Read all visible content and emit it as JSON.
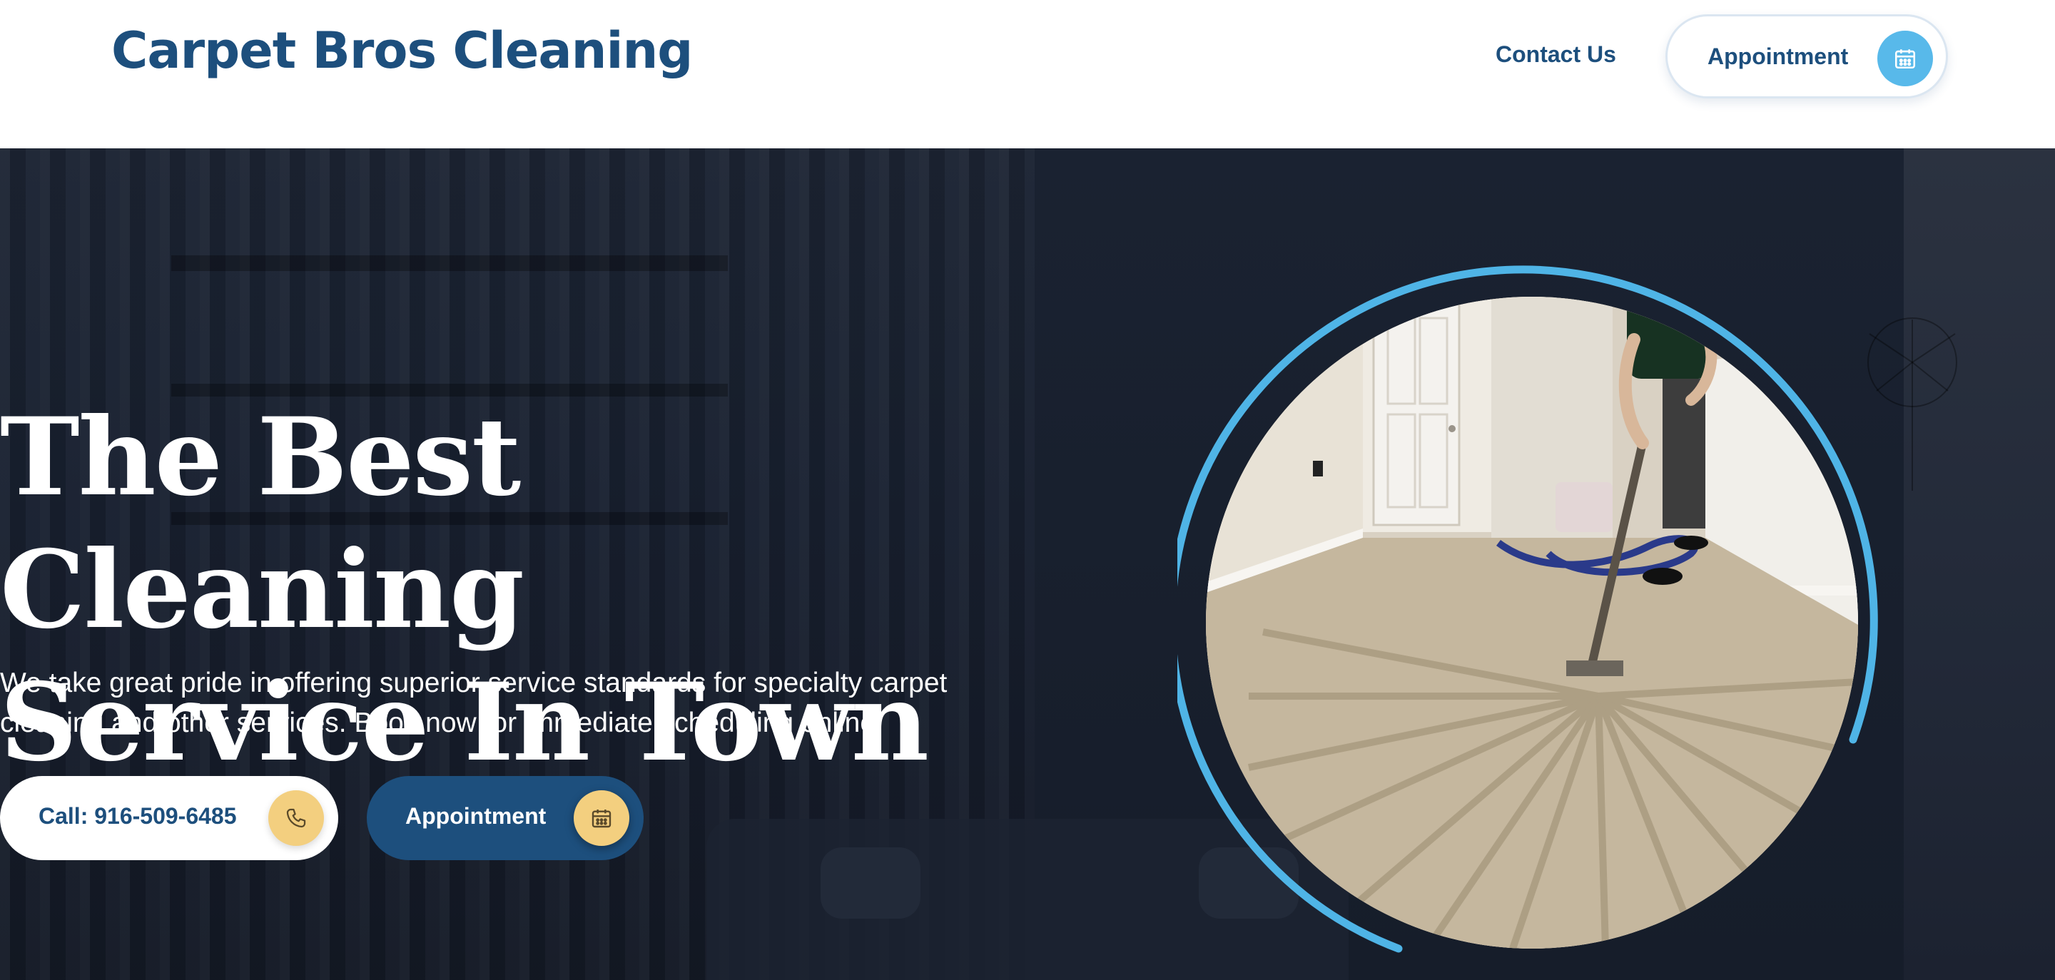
{
  "header": {
    "logo_text": "Carpet Bros Cleaning",
    "nav": {
      "contact_label": "Contact Us",
      "appointment_label": "Appointment"
    }
  },
  "hero": {
    "title_line1": "The Best Cleaning",
    "title_line2": "Service In Town",
    "description": "We take great pride in offering superior service standards for specialty carpet cleaning and other services. Book now for immediate scheduling online.",
    "call_button_label": "Call: 916-509-6485",
    "appointment_button_label": "Appointment",
    "image_alt": "Technician cleaning a carpet with a wand"
  },
  "icons": {
    "calendar": "calendar-icon",
    "phone": "phone-icon"
  },
  "colors": {
    "brand_blue": "#1d4f7d",
    "accent_sky": "#58b9ea",
    "accent_gold": "#f3cf7f",
    "hero_bg": "#151c29"
  }
}
